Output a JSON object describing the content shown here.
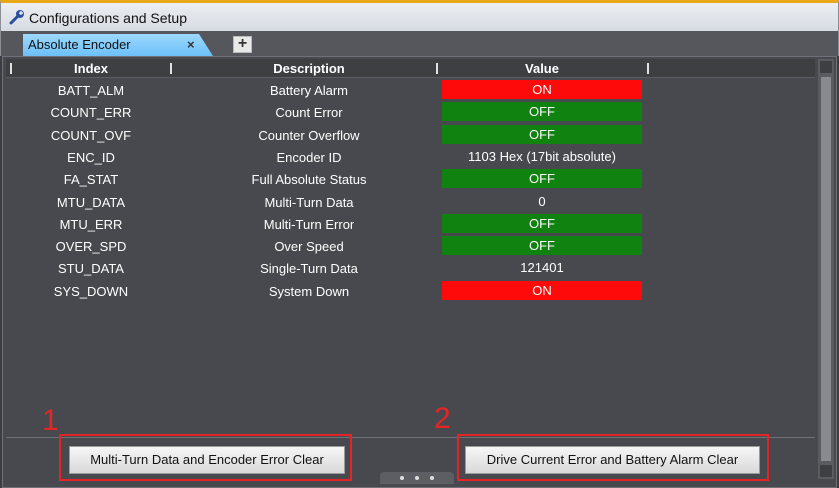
{
  "window": {
    "title": "Configurations and Setup"
  },
  "tabs": [
    {
      "label": "Absolute Encoder",
      "close": "×"
    }
  ],
  "add_tab_label": "+",
  "table": {
    "columns": [
      "Index",
      "Description",
      "Value"
    ],
    "rows": [
      {
        "index": "BATT_ALM",
        "description": "Battery Alarm",
        "value": "ON",
        "status": "on"
      },
      {
        "index": "COUNT_ERR",
        "description": "Count Error",
        "value": "OFF",
        "status": "off"
      },
      {
        "index": "COUNT_OVF",
        "description": "Counter Overflow",
        "value": "OFF",
        "status": "off"
      },
      {
        "index": "ENC_ID",
        "description": "Encoder ID",
        "value": "1103 Hex (17bit absolute)",
        "status": "plain"
      },
      {
        "index": "FA_STAT",
        "description": "Full Absolute Status",
        "value": "OFF",
        "status": "off"
      },
      {
        "index": "MTU_DATA",
        "description": "Multi-Turn Data",
        "value": "0",
        "status": "plain"
      },
      {
        "index": "MTU_ERR",
        "description": "Multi-Turn Error",
        "value": "OFF",
        "status": "off"
      },
      {
        "index": "OVER_SPD",
        "description": "Over Speed",
        "value": "OFF",
        "status": "off"
      },
      {
        "index": "STU_DATA",
        "description": "Single-Turn Data",
        "value": "121401",
        "status": "plain"
      },
      {
        "index": "SYS_DOWN",
        "description": "System Down",
        "value": "ON",
        "status": "on"
      }
    ]
  },
  "buttons": {
    "multi_turn_clear": "Multi-Turn Data and Encoder Error Clear",
    "drive_current_clear": "Drive Current Error and Battery Alarm Clear"
  },
  "callouts": {
    "first": "1",
    "second": "2"
  },
  "colors": {
    "on": "#ff0a0a",
    "off": "#0f820f",
    "tab_active": "#6cc0f8",
    "callout_red": "#e52525",
    "title_accent": "#e8a817"
  },
  "icons": [
    "wrench-icon",
    "fit-view-icon",
    "zoom-in-icon",
    "zoom-out-icon"
  ]
}
